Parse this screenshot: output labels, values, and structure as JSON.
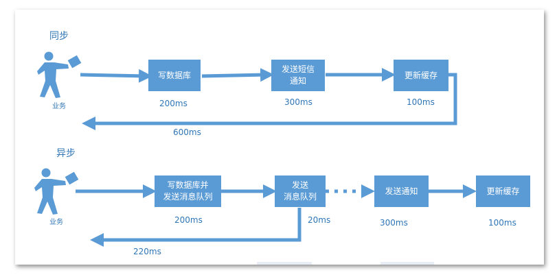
{
  "sync": {
    "title": "同步",
    "actor_label": "业务",
    "steps": [
      {
        "label": "写数据库",
        "time": "200ms"
      },
      {
        "label": "发送短信\n通知",
        "time": "300ms"
      },
      {
        "label": "更新缓存",
        "time": "100ms"
      }
    ],
    "return_time": "600ms"
  },
  "async": {
    "title": "异步",
    "actor_label": "业务",
    "steps": [
      {
        "label": "写数据库并\n发送消息队列",
        "time": "200ms"
      },
      {
        "label": "发送\n消息队列",
        "time": "20ms"
      },
      {
        "label": "发送通知",
        "time": "300ms"
      },
      {
        "label": "更新缓存",
        "time": "100ms"
      }
    ],
    "return_time": "220ms"
  },
  "colors": {
    "box": "#5b9bd5",
    "arrow": "#5b9bd5",
    "text": "#2e75b6"
  },
  "icons": {
    "actor": "person-with-paper-icon"
  }
}
